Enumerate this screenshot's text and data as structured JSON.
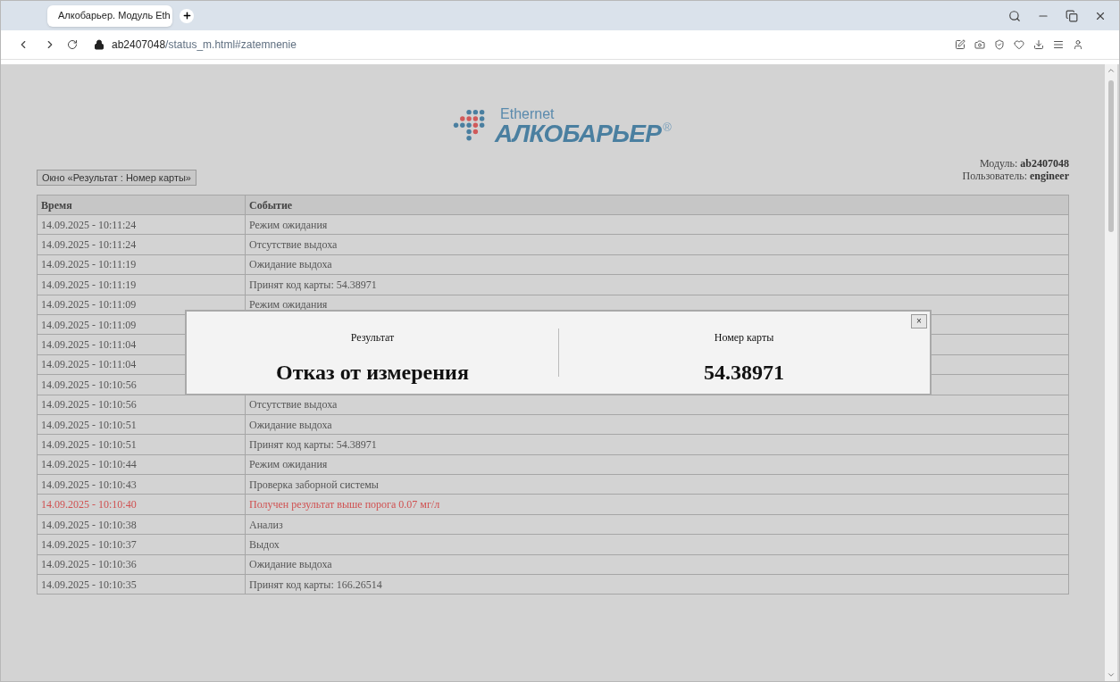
{
  "browser": {
    "tab_title": "Алкобарьер. Модуль Eth",
    "url_host": "ab2407048",
    "url_path": "/status_m.html#zatemnenie"
  },
  "logo": {
    "tagline": "Ethernet",
    "brand": "АЛКОБАРЬЕР",
    "mark": "®"
  },
  "window_button": "Окно «Результат : Номер карты»",
  "info": [
    {
      "label": "Модуль:",
      "value": "ab2407048"
    },
    {
      "label": "Пользователь:",
      "value": "engineer"
    }
  ],
  "table": {
    "columns": [
      "Время",
      "Событие"
    ],
    "rows": [
      {
        "time": "14.09.2025 - 10:11:24",
        "event": "Режим ожидания",
        "alert": false
      },
      {
        "time": "14.09.2025 - 10:11:24",
        "event": "Отсутствие выдоха",
        "alert": false
      },
      {
        "time": "14.09.2025 - 10:11:19",
        "event": "Ожидание выдоха",
        "alert": false
      },
      {
        "time": "14.09.2025 - 10:11:19",
        "event": "Принят код карты: 54.38971",
        "alert": false
      },
      {
        "time": "14.09.2025 - 10:11:09",
        "event": "Режим ожидания",
        "alert": false
      },
      {
        "time": "14.09.2025 - 10:11:09",
        "alert": false
      },
      {
        "time": "14.09.2025 - 10:11:04",
        "alert": false
      },
      {
        "time": "14.09.2025 - 10:11:04",
        "alert": false
      },
      {
        "time": "14.09.2025 - 10:10:56",
        "alert": false
      },
      {
        "time": "14.09.2025 - 10:10:56",
        "event": "Отсутствие выдоха",
        "alert": false
      },
      {
        "time": "14.09.2025 - 10:10:51",
        "event": "Ожидание выдоха",
        "alert": false
      },
      {
        "time": "14.09.2025 - 10:10:51",
        "event": "Принят код карты: 54.38971",
        "alert": false
      },
      {
        "time": "14.09.2025 - 10:10:44",
        "event": "Режим ожидания",
        "alert": false
      },
      {
        "time": "14.09.2025 - 10:10:43",
        "event": "Проверка заборной системы",
        "alert": false
      },
      {
        "time": "14.09.2025 - 10:10:40",
        "event": "Получен результат выше порога 0.07 мг/л",
        "alert": true
      },
      {
        "time": "14.09.2025 - 10:10:38",
        "event": "Анализ",
        "alert": false
      },
      {
        "time": "14.09.2025 - 10:10:37",
        "event": "Выдох",
        "alert": false
      },
      {
        "time": "14.09.2025 - 10:10:36",
        "event": "Ожидание выдоха",
        "alert": false
      },
      {
        "time": "14.09.2025 - 10:10:35",
        "event": "Принят код карты: 166.26514",
        "alert": false
      }
    ]
  },
  "dialog": {
    "close": "×",
    "panels": [
      {
        "label": "Результат",
        "value": "Отказ от измерения"
      },
      {
        "label": "Номер карты",
        "value": "54.38971"
      }
    ]
  }
}
